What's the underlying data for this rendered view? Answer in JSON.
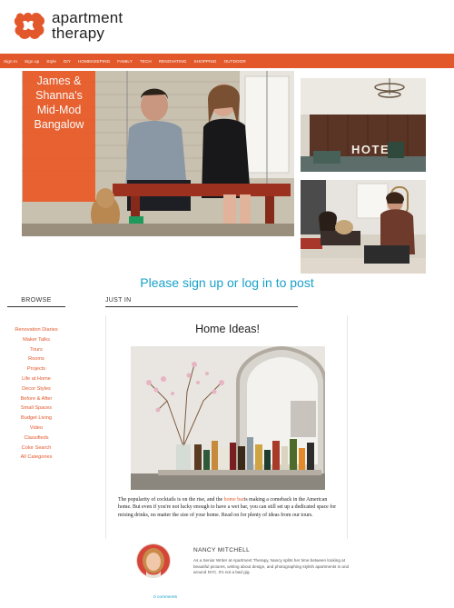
{
  "brand": {
    "line1": "apartment",
    "line2": "therapy",
    "logo_color": "#e2582b"
  },
  "nav": {
    "items": [
      "Sign In",
      "Sign up",
      "Style",
      "DIY",
      "HOMEKEEPING",
      "FAMILY",
      "TECH",
      "RENOVATING",
      "SHOPPING",
      "OUTDOOR"
    ],
    "bar_color": "#e2582b"
  },
  "hero": {
    "caption_lines": [
      "James &",
      "Shanna's",
      "Mid-Mod",
      "Bangalow"
    ],
    "side_top_sign": "HOTEL"
  },
  "signup_text": "Please sign up or log in to post",
  "sidebar": {
    "title": "BROWSE",
    "items": [
      "Renovation Diaries",
      "Maker Talks",
      "Tours",
      "Rooms",
      "Projects",
      "Life at Home",
      "Decor Styles",
      "Before & After",
      "Small Spaces",
      "Budget Living",
      "Video",
      "Classifieds",
      "Color Search",
      "All Categories"
    ]
  },
  "feed": {
    "title": "JUST IN"
  },
  "article": {
    "title": "Home Ideas!",
    "text_before": "The popularity of cocktails is on the rise, and the ",
    "link_text": "home bar",
    "text_after": "is making a comeback in the American home. But even if you're not lucky enough to have a wet bar, you can still set up a dedicated space for mixing drinks, no matter the size of your home. Read on for plenty of ideas from our tours."
  },
  "author": {
    "name": "NANCY MITCHELL",
    "bio": "As a Senior Writer at Apartment Therapy, Nancy splits her time between looking at beautiful pictures, writing about design, and photographing stylish apartments in and around NYC. It's not a bad gig."
  },
  "comments": "0 comments",
  "colors": {
    "accent": "#e2582b",
    "link_blue": "#19a1c9"
  }
}
